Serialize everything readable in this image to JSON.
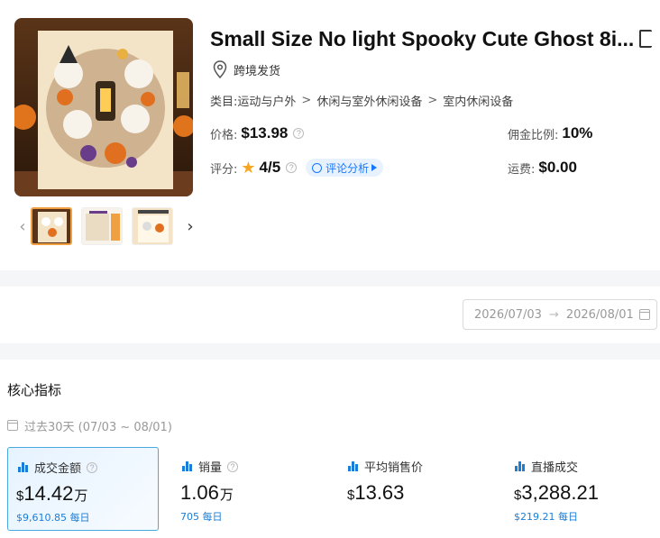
{
  "product": {
    "title": "Small Size No light Spooky Cute Ghost 8i...",
    "origin": "跨境发货",
    "category_label": "类目:",
    "categories": [
      "运动与户外",
      "休闲与室外休闲设备",
      "室内休闲设备"
    ],
    "price_label": "价格:",
    "price": "$13.98",
    "commission_label": "佣金比例:",
    "commission": "10%",
    "rating_label": "评分:",
    "rating": "4/5",
    "review_button": "评论分析",
    "shipping_label": "运费:",
    "shipping": "$0.00"
  },
  "date_range": {
    "start": "2026/07/03",
    "end": "2026/08/01"
  },
  "metrics_section": {
    "title": "核心指标",
    "period": "过去30天 (07/03 ~ 08/01)",
    "cards": [
      {
        "label": "成交金额",
        "symbol": "$",
        "value": "14.42",
        "unit": "万",
        "sub": "$9,610.85 每日"
      },
      {
        "label": "销量",
        "symbol": "",
        "value": "1.06",
        "unit": "万",
        "sub": "705 每日"
      },
      {
        "label": "平均销售价",
        "symbol": "$",
        "value": "13.63",
        "unit": "",
        "sub": ""
      },
      {
        "label": "直播成交",
        "symbol": "$",
        "value": "3,288.21",
        "unit": "",
        "sub": "$219.21 每日"
      }
    ]
  },
  "colors": {
    "accent": "#1a7dd7",
    "star": "#f5a623",
    "active_border": "#4aa8e0"
  }
}
